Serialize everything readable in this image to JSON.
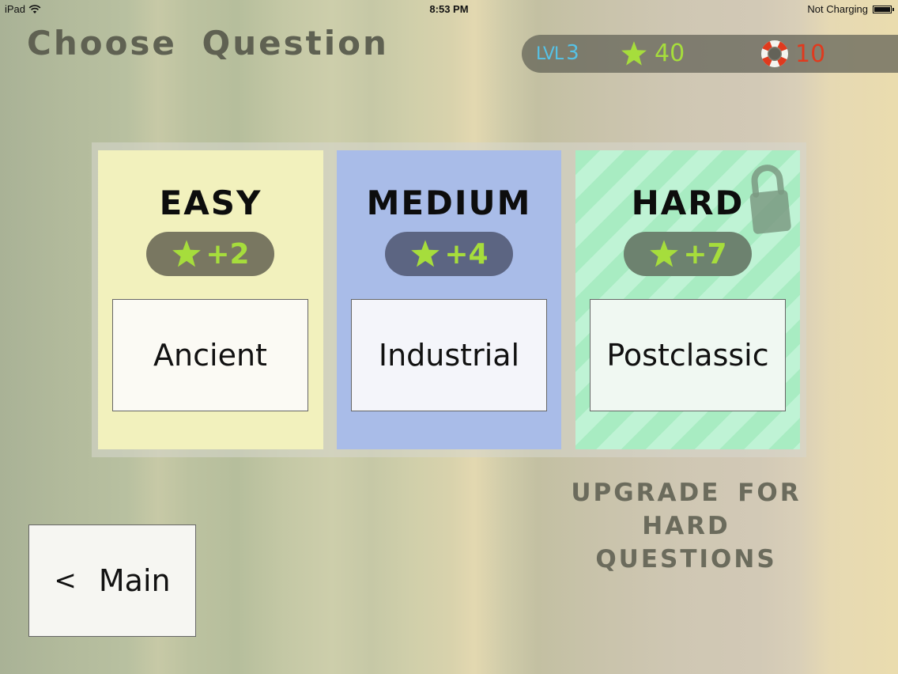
{
  "status_bar": {
    "device": "iPad",
    "time": "8:53 PM",
    "charging": "Not Charging"
  },
  "page": {
    "title": "Choose Question"
  },
  "hud": {
    "level_label": "LVL",
    "level_value": "3",
    "stars": "40",
    "lives": "10",
    "colors": {
      "level": "#56c2e6",
      "stars": "#a6dd3c",
      "lives": "#e03a1e"
    }
  },
  "cards": {
    "easy": {
      "title": "EASY",
      "reward": "+2",
      "topic": "Ancient",
      "color": "#f2f1bd"
    },
    "medium": {
      "title": "MEDIUM",
      "reward": "+4",
      "topic": "Industrial",
      "color": "#a9bce8"
    },
    "hard": {
      "title": "HARD",
      "reward": "+7",
      "topic": "Postclassic",
      "color": "#a8ecc2",
      "locked": true
    }
  },
  "upgrade": {
    "line1": "UPGRADE FOR",
    "line2": "HARD",
    "line3": "QUESTIONS"
  },
  "nav": {
    "back_glyph": "<",
    "back_label": "Main"
  },
  "icons": {
    "wifi": "wifi-icon",
    "battery": "battery-icon",
    "star": "star-icon",
    "lifebuoy": "lifebuoy-icon",
    "lock": "lock-icon"
  }
}
